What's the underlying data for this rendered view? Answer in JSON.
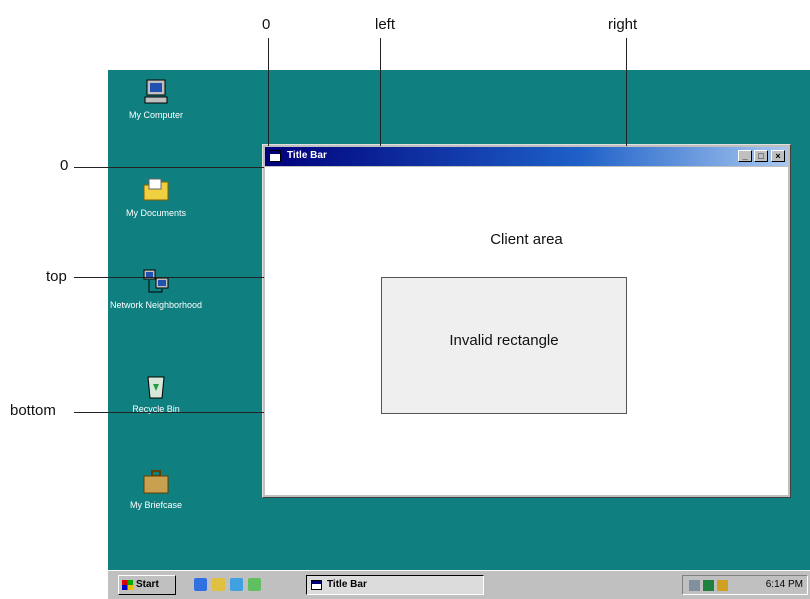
{
  "annotations": {
    "x_origin": "0",
    "left": "left",
    "right": "right",
    "y_origin": "0",
    "top": "top",
    "bottom": "bottom"
  },
  "desktop_icons": [
    {
      "label": "My Computer",
      "icon": "computer-icon"
    },
    {
      "label": "My Documents",
      "icon": "folder-icon"
    },
    {
      "label": "Network Neighborhood",
      "icon": "network-icon"
    },
    {
      "label": "Recycle Bin",
      "icon": "recycle-bin-icon"
    },
    {
      "label": "My Briefcase",
      "icon": "briefcase-icon"
    }
  ],
  "window": {
    "title": "Title Bar",
    "buttons": {
      "minimize": "_",
      "maximize": "□",
      "close": "×"
    },
    "client_label": "Client area",
    "invalid_label": "Invalid rectangle"
  },
  "taskbar": {
    "start_label": "Start",
    "task_label": "Title Bar",
    "clock": "6:14 PM",
    "quick_launch": [
      "ie-icon",
      "outlook-icon",
      "desktop-icon",
      "channels-icon"
    ],
    "tray_icons": [
      "network-tray-icon",
      "volume-icon",
      "scheduler-icon"
    ]
  },
  "colors": {
    "desktop": "#0f7f80",
    "titlebar_start": "#00007b",
    "titlebar_end": "#a8c8f0"
  }
}
